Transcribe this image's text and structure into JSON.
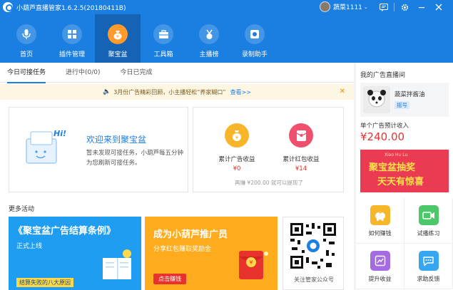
{
  "app": {
    "title": "小葫芦直播管家1.6.2.5(20180411B)",
    "user_name": "蔬菜1111",
    "user_caret": "⌄"
  },
  "titlebar_icons": [
    "chat-icon",
    "gear-icon",
    "minimize-icon",
    "close-icon"
  ],
  "nav": {
    "items": [
      {
        "label": "首页",
        "icon": "microphone-icon"
      },
      {
        "label": "插件管理",
        "icon": "plugin-grid-icon"
      },
      {
        "label": "聚宝盆",
        "icon": "treasure-bag-icon",
        "active": true
      },
      {
        "label": "工具箱",
        "icon": "toolbox-icon"
      },
      {
        "label": "主播榜",
        "icon": "medal-icon"
      },
      {
        "label": "录制助手",
        "icon": "record-icon"
      }
    ],
    "colors": {
      "bar": "#1a7fe0",
      "active": "#1563b5",
      "accent": "#ff9b2c"
    }
  },
  "tabs": [
    {
      "label": "今日可接任务",
      "active": true
    },
    {
      "label": "进行中(0/0)",
      "active": false
    },
    {
      "label": "今日已完成",
      "active": false
    }
  ],
  "notice": {
    "text": "3月份广告精彩回顾，小主播轻松“养家糊口”",
    "link": "查看>>",
    "close": "✕"
  },
  "welcome": {
    "title": "欢迎来到聚宝盆",
    "text": "暂未发现可接任务，小葫芦每五分钟为您刷新可接任务。",
    "hi": "Hi!"
  },
  "income": {
    "ad_label": "累计广告收益",
    "ad_value": "¥0",
    "hongbao_label": "累计红包收益",
    "hongbao_value": "¥14",
    "note": "再赚 ¥200.00 就可以提现了",
    "colors": {
      "ad": "#f7b52a",
      "hongbao": "#f0506e",
      "value": "#e8322d"
    }
  },
  "more": {
    "title": "更多活动",
    "banner1": {
      "title": "《聚宝盆广告结算条例》",
      "sub": "正式上线",
      "tag": "结算失败的八大原因"
    },
    "banner2": {
      "title": "成为小葫芦推广员",
      "sub": "分享红包赚取奖励金",
      "button": "点击赚钱"
    },
    "qr": {
      "label": "关注管家公众号"
    }
  },
  "side": {
    "title": "我的广告直播间",
    "user_name": "蔬菜拌酱油",
    "user_badge": "摇号",
    "income_label": "单个广告预计收入",
    "income_value": "¥240.00",
    "promo": {
      "en": "Xiao Hu Lu",
      "line1": "聚宝盆抽奖",
      "line2": "天天有惊喜"
    }
  },
  "grid": [
    {
      "label": "如何赚钱",
      "icon": "piggy-bank-icon",
      "color": "#f7b52a"
    },
    {
      "label": "试播练习",
      "icon": "video-icon",
      "color": "#4cc86a"
    },
    {
      "label": "提升收益",
      "icon": "trend-icon",
      "color": "#a56be0"
    },
    {
      "label": "求助反馈",
      "icon": "speech-bubble-icon",
      "color": "#36a6f0"
    }
  ]
}
